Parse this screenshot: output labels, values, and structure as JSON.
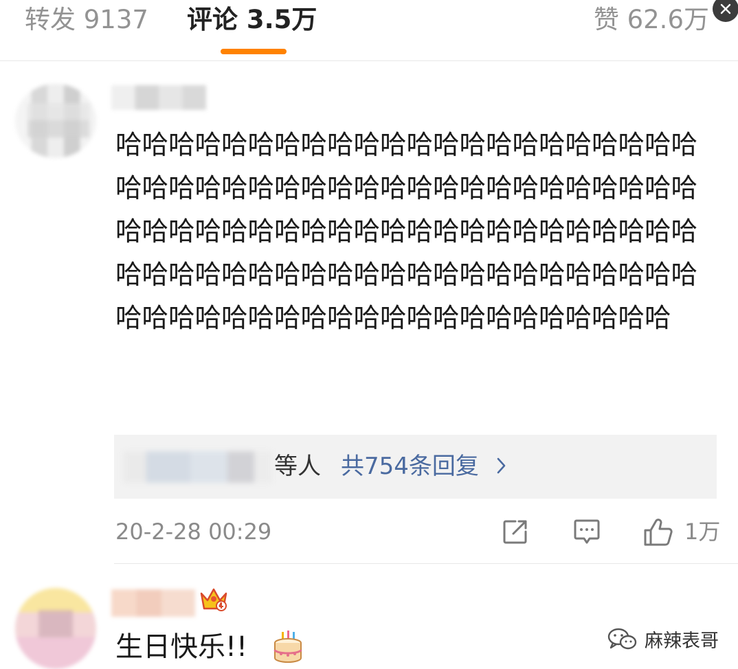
{
  "tabs": {
    "repost": "转发 9137",
    "comment": "评论 3.5万",
    "like": "赞 62.6万"
  },
  "comment1": {
    "text": "哈哈哈哈哈哈哈哈哈哈哈哈哈哈哈哈哈哈哈哈哈哈哈哈哈哈哈哈哈哈哈哈哈哈哈哈哈哈哈哈哈哈哈哈哈哈哈哈哈哈哈哈哈哈哈哈哈哈哈哈哈哈哈哈哈哈哈哈哈哈哈哈哈哈哈哈哈哈哈哈哈哈哈哈哈哈哈哈哈哈哈哈哈哈哈哈哈哈哈哈哈哈哈哈哈哈哈哈哈",
    "reply_suffix": "等人",
    "reply_link": "共754条回复",
    "timestamp": "20-2-28 00:29",
    "like_count": "1万"
  },
  "comment2": {
    "text": "生日快乐!!"
  },
  "watermark": {
    "label": "麻辣表哥",
    "icon": "wechat-icon"
  },
  "colors": {
    "accent": "#ff8200",
    "link": "#4a6aa0",
    "muted": "#8a8a8a"
  }
}
